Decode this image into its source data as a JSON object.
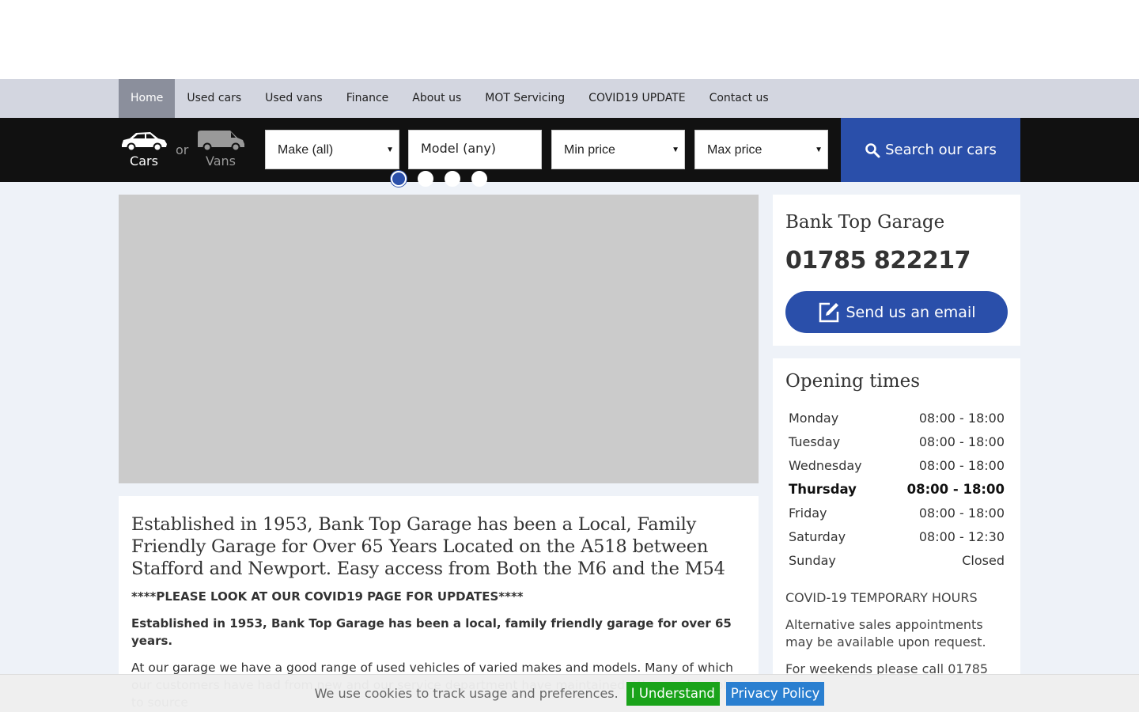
{
  "nav": {
    "items": [
      {
        "label": "Home",
        "active": true
      },
      {
        "label": "Used cars"
      },
      {
        "label": "Used vans"
      },
      {
        "label": "Finance"
      },
      {
        "label": "About us"
      },
      {
        "label": "MOT Servicing"
      },
      {
        "label": "COVID19 UPDATE"
      },
      {
        "label": "Contact us"
      }
    ]
  },
  "search": {
    "cars_label": "Cars",
    "or_label": "or",
    "vans_label": "Vans",
    "make": "Make (all)",
    "model": "Model (any)",
    "min_price": "Min price",
    "max_price": "Max price",
    "button_label": "Search our cars",
    "icons": {
      "cars": "car-icon",
      "vans": "van-icon",
      "search": "search-icon"
    }
  },
  "slider": {
    "dot_count": 4,
    "active_dot": 1
  },
  "content": {
    "heading": "Established in 1953, Bank Top Garage has been a Local, Family Friendly Garage for Over 65 Years Located on the A518 between Stafford and Newport. Easy access from Both the M6 and the M54",
    "covid_notice": "****PLEASE LOOK AT OUR COVID19 PAGE FOR UPDATES****",
    "intro_bold": "Established in 1953, Bank Top Garage has been a local, family friendly garage for over 65 years.",
    "paragraph": "At our garage we  have a good range of used vehicles of varied makes and models. Many of which our customers have had from new and our service department have maintained. We are also able to source"
  },
  "contact": {
    "name": "Bank Top Garage",
    "phone": "01785 822217",
    "email_button": "Send us an email",
    "email_icon": "edit-icon"
  },
  "hours": {
    "title": "Opening times",
    "days": [
      {
        "day": "Monday",
        "time": "08:00 - 18:00"
      },
      {
        "day": "Tuesday",
        "time": "08:00 - 18:00"
      },
      {
        "day": "Wednesday",
        "time": "08:00 - 18:00"
      },
      {
        "day": "Thursday",
        "time": "08:00 - 18:00",
        "today": true
      },
      {
        "day": "Friday",
        "time": "08:00 - 18:00"
      },
      {
        "day": "Saturday",
        "time": "08:00 - 12:30"
      },
      {
        "day": "Sunday",
        "time": "Closed"
      }
    ],
    "note_title": "COVID-19 TEMPORARY HOURS",
    "note_1": "Alternative sales appointments may be available upon request.",
    "note_2": "For weekends please call 01785"
  },
  "cookie": {
    "text": "We use cookies to track usage and preferences.",
    "accept": "I Understand",
    "policy": "Privacy Policy"
  },
  "colors": {
    "brand_blue": "#2a4faa",
    "nav_bg": "#d3d6e0",
    "search_bar_bg": "#111111",
    "cookie_accept": "#1aa31a",
    "cookie_policy": "#2a7fd0"
  }
}
